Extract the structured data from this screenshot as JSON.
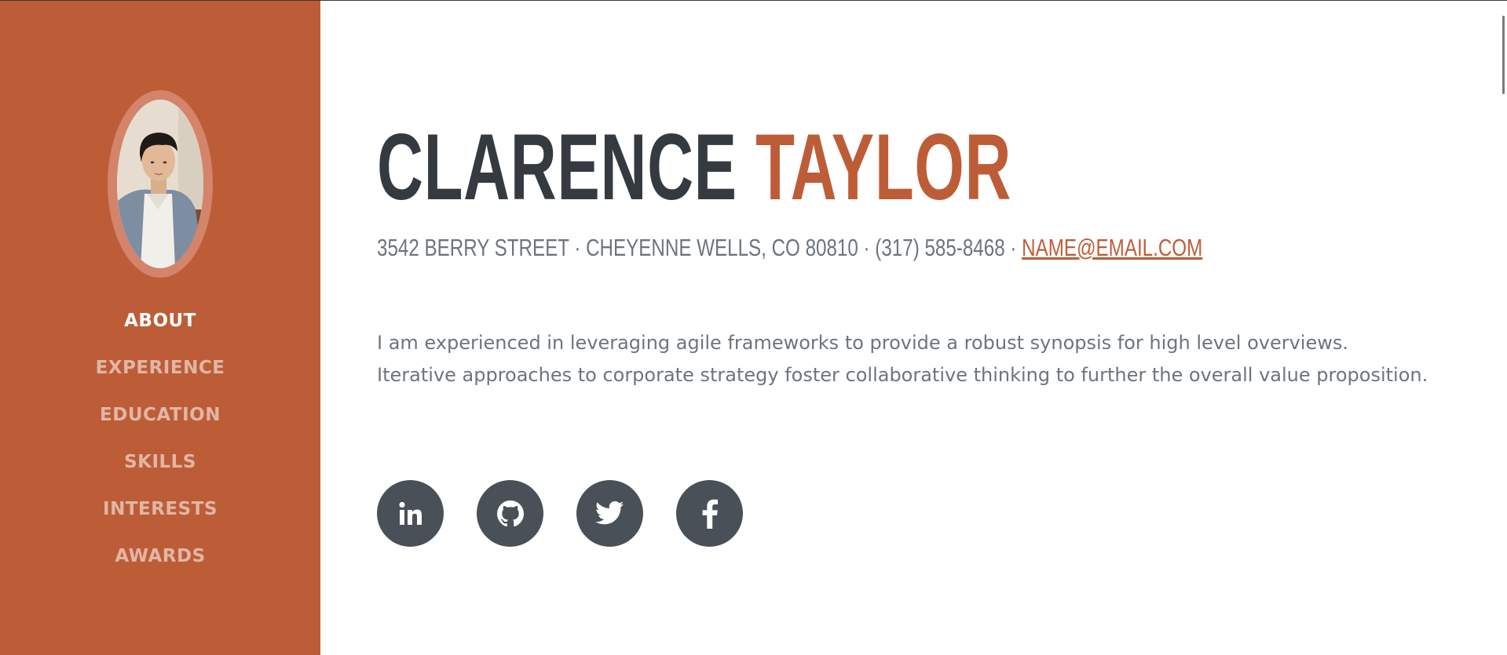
{
  "profile": {
    "first_name": "CLARENCE",
    "last_name": "TAYLOR",
    "contact_prefix": "3542 BERRY STREET · CHEYENNE WELLS, CO 80810 · (317) 585-8468 · ",
    "email": "NAME@EMAIL.COM",
    "bio": "I am experienced in leveraging agile frameworks to provide a robust synopsis for high level overviews. Iterative approaches to corporate strategy foster collaborative thinking to further the overall value proposition."
  },
  "nav": {
    "items": [
      {
        "label": "ABOUT",
        "active": true
      },
      {
        "label": "EXPERIENCE",
        "active": false
      },
      {
        "label": "EDUCATION",
        "active": false
      },
      {
        "label": "SKILLS",
        "active": false
      },
      {
        "label": "INTERESTS",
        "active": false
      },
      {
        "label": "AWARDS",
        "active": false
      }
    ]
  },
  "social": {
    "icons": [
      "linkedin-icon",
      "github-icon",
      "twitter-icon",
      "facebook-icon"
    ]
  },
  "colors": {
    "primary": "#bd5d38",
    "dark": "#343a40",
    "muted": "#6c757d",
    "social_bg": "#495057"
  }
}
